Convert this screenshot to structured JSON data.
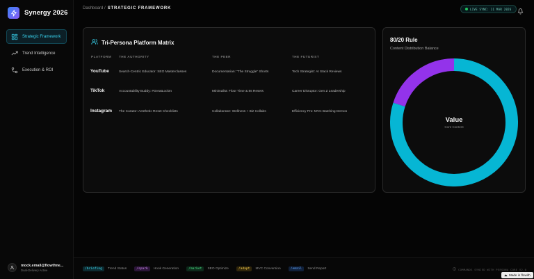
{
  "app": {
    "name": "Synergy 2026"
  },
  "sidebar": {
    "items": [
      {
        "label": "Strategic Framework",
        "icon": "layout-grid-icon",
        "active": true
      },
      {
        "label": "Trend Intelligence",
        "icon": "trending-up-icon",
        "active": false
      },
      {
        "label": "Execution & ROI",
        "icon": "workflow-icon",
        "active": false
      }
    ],
    "user": {
      "email": "mock.email@flowthne...",
      "status": "Dual-Delivery Active"
    }
  },
  "header": {
    "breadcrumb_root": "Dashboard /",
    "breadcrumb_current": "STRATEGIC FRAMEWORK",
    "sync": "LIVE SYNC: 11 MAR 2026"
  },
  "matrix": {
    "title": "Tri-Persona Platform Matrix",
    "columns": [
      "PLATFORM",
      "THE AUTHORITY",
      "THE PEER",
      "THE FUTURIST"
    ],
    "rows": [
      {
        "platform": "YouTube",
        "cells": [
          "Search-Centric Educator: SEO Masterclasses",
          "Documentarian: \"The Struggle\" Shorts",
          "Tech Strategist: AI Stack Reviews"
        ]
      },
      {
        "platform": "TikTok",
        "cells": [
          "Accountability Buddy: #GreatLockIn",
          "Minimalist: Floor Time & 8s Resets",
          "Career Disruptor: Gen Z Leadership"
        ]
      },
      {
        "platform": "Instagram",
        "cells": [
          "The Curator: Aesthetic Reset Checklists",
          "Collaborator: Wellness + Biz Collabs",
          "Efficiency Pro: MVC Batching Demos"
        ]
      }
    ]
  },
  "rule": {
    "title": "80/20 Rule",
    "subtitle": "Content Distribution Balance",
    "center_label": "Value",
    "center_sub": "Core Content",
    "segments": [
      {
        "share": 80,
        "color": "#06b6d4"
      },
      {
        "share": 20,
        "color": "#9333ea"
      }
    ]
  },
  "commands": [
    {
      "code": "/briefing",
      "label": "Trend Status",
      "bg": "#0c2b31",
      "fg": "#3fd4ec"
    },
    {
      "code": "/spark",
      "label": "Hook Generation",
      "bg": "#2b1538",
      "fg": "#d08cf2"
    },
    {
      "code": "/market",
      "label": "SEO Optimize",
      "bg": "#0d2a1b",
      "fg": "#4ade80"
    },
    {
      "code": "/adapt",
      "label": "MVC Conversion",
      "bg": "#30260b",
      "fg": "#f2c94c"
    },
    {
      "code": "/email",
      "label": "Send Report",
      "bg": "#10203a",
      "fg": "#60a5fa"
    }
  ],
  "footer": {
    "status": "COMMANDS SYNCED WITH PERSONA CORE V2.0",
    "made_in": "Made in flowith"
  },
  "colors": {
    "accent": "#38d3ee",
    "sync_dot": "#22c55e"
  }
}
